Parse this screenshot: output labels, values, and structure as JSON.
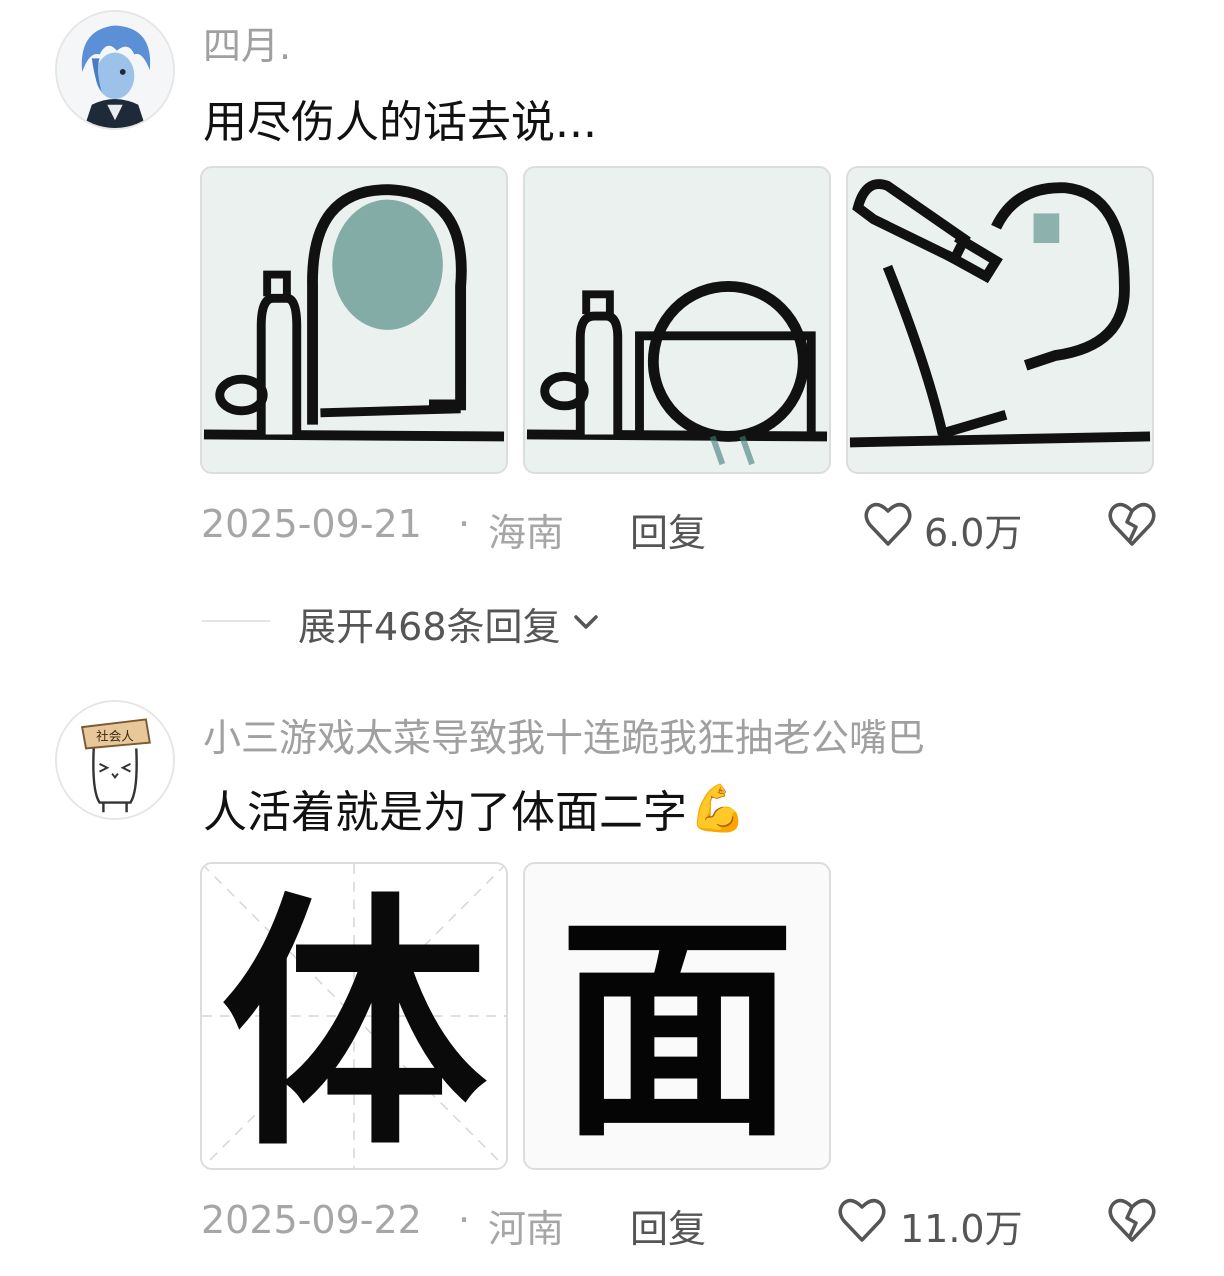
{
  "comments": [
    {
      "username": "四月.",
      "text": "用尽伤人的话去说...",
      "date": "2025-09-21",
      "location": "海南",
      "separator": "·",
      "reply_label": "回复",
      "likes": "6.0万",
      "expand_label": "展开468条回复",
      "avatar": "blue-hair-anime-avatar",
      "images": [
        "meme-drinking-panel-1",
        "meme-drinking-panel-2",
        "meme-drinking-panel-3"
      ]
    },
    {
      "username": "小三游戏太菜导致我十连跪我狂抽老公嘴巴",
      "text": "人活着就是为了体面二字",
      "emoji": "💪",
      "date": "2025-09-22",
      "location": "河南",
      "separator": "·",
      "reply_label": "回复",
      "likes": "11.0万",
      "avatar": "shehuiren-cat-avatar",
      "avatar_text": "社会人",
      "images": [
        {
          "name": "character-ti-image",
          "char": "体"
        },
        {
          "name": "character-mian-image",
          "char": "面"
        }
      ]
    }
  ],
  "icons": {
    "like": "heart-outline-icon",
    "dislike": "broken-heart-icon",
    "expand": "chevron-down-icon"
  },
  "colors": {
    "meta_text": "#a6a6a6",
    "username": "#a0a0a0",
    "body_text": "#111111",
    "avatar_hair": "#5b8fd6"
  }
}
